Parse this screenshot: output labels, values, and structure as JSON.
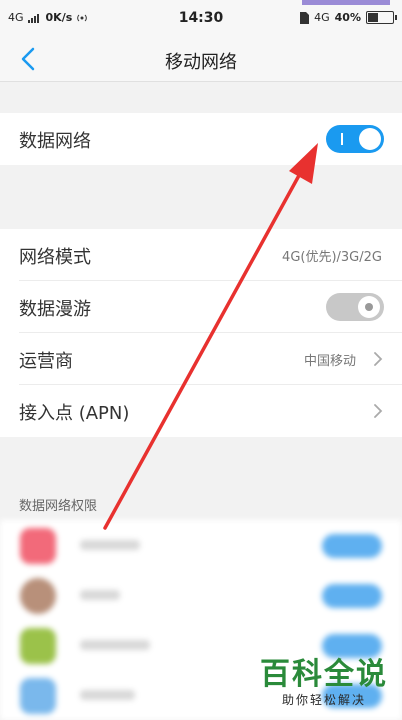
{
  "status_bar": {
    "network_type": "4G",
    "speed": "0K/s",
    "time": "14:30",
    "right_network": "4G",
    "battery": "40%",
    "battery_level": 0.4
  },
  "header": {
    "title": "移动网络",
    "back_icon": "chevron-left-icon"
  },
  "settings": {
    "data_network": {
      "label": "数据网络",
      "enabled": true
    },
    "network_mode": {
      "label": "网络模式",
      "value": "4G(优先)/3G/2G"
    },
    "data_roaming": {
      "label": "数据漫游",
      "enabled": false
    },
    "carrier": {
      "label": "运营商",
      "value": "中国移动"
    },
    "apn": {
      "label": "接入点 (APN)"
    }
  },
  "permissions": {
    "section_title": "数据网络权限"
  },
  "watermark": {
    "title": "百科全说",
    "subtitle": "助你轻松解决"
  },
  "colors": {
    "accent": "#1a9af0",
    "annotation_arrow": "#e8312f",
    "watermark_green": "#2a8a3a"
  }
}
